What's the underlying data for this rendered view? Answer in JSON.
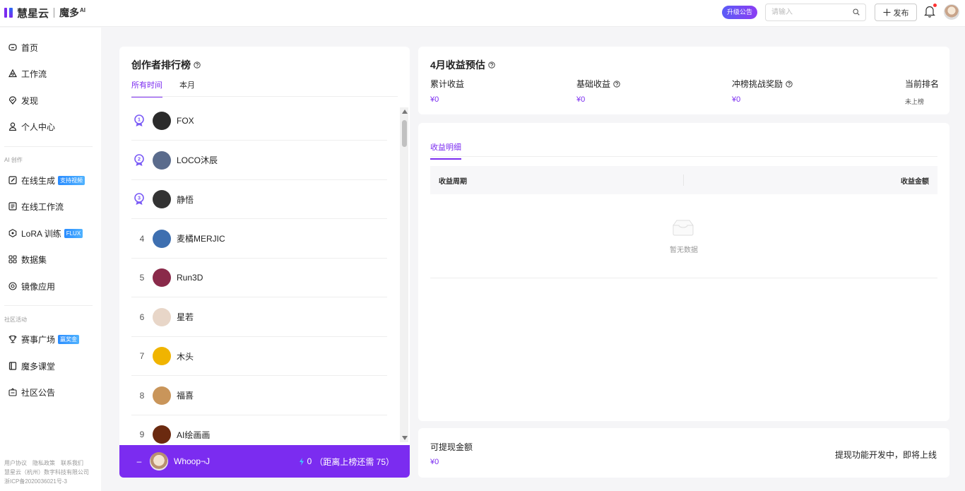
{
  "header": {
    "logo_text": "慧星云",
    "logo_sub": "魔多",
    "logo_sup": "AI",
    "announce_label": "升级公告",
    "search_placeholder": "请输入",
    "publish_label": "发布"
  },
  "sidebar": {
    "nav_main": [
      {
        "label": "首页",
        "icon": "home-icon"
      },
      {
        "label": "工作流",
        "icon": "workflow-icon"
      },
      {
        "label": "发现",
        "icon": "discover-icon"
      },
      {
        "label": "个人中心",
        "icon": "user-icon"
      }
    ],
    "section_ai": "AI 创作",
    "nav_ai": [
      {
        "label": "在线生成",
        "icon": "edit-icon",
        "badge": "支持视频"
      },
      {
        "label": "在线工作流",
        "icon": "doc-icon",
        "badge": ""
      },
      {
        "label": "LoRA 训练",
        "icon": "lora-icon",
        "badge": "FLUX"
      },
      {
        "label": "数据集",
        "icon": "dataset-icon",
        "badge": ""
      },
      {
        "label": "镜像应用",
        "icon": "mirror-icon",
        "badge": ""
      }
    ],
    "section_community": "社区活动",
    "nav_community": [
      {
        "label": "赛事广场",
        "icon": "trophy-icon",
        "badge": "赢奖金"
      },
      {
        "label": "魔多课堂",
        "icon": "book-icon",
        "badge": ""
      },
      {
        "label": "社区公告",
        "icon": "announcement-icon",
        "badge": ""
      }
    ],
    "footer": {
      "links": [
        "用户协议",
        "隐私政策",
        "联系我们"
      ],
      "company": "慧星云（杭州）数字科技有限公司",
      "icp": "浙ICP备2020036021号-3"
    }
  },
  "leaderboard": {
    "title": "创作者排行榜",
    "tabs": [
      "所有时间",
      "本月"
    ],
    "active_tab": 0,
    "rows": [
      {
        "rank": "1",
        "name": "FOX",
        "avatar_color": "#2b2b2b"
      },
      {
        "rank": "2",
        "name": "LOCO沐辰",
        "avatar_color": "#5a6b8c"
      },
      {
        "rank": "3",
        "name": "静悟",
        "avatar_color": "#333333"
      },
      {
        "rank": "4",
        "name": "麦橘MERJIC",
        "avatar_color": "#3e6fb0"
      },
      {
        "rank": "5",
        "name": "Run3D",
        "avatar_color": "#8a2a4a"
      },
      {
        "rank": "6",
        "name": "星若",
        "avatar_color": "#e8d6c8"
      },
      {
        "rank": "7",
        "name": "木头",
        "avatar_color": "#f0b400"
      },
      {
        "rank": "8",
        "name": "福喜",
        "avatar_color": "#c9955a"
      },
      {
        "rank": "9",
        "name": "AI绘画画",
        "avatar_color": "#6b2a10"
      }
    ],
    "me": {
      "rank": "–",
      "name": "Whoop¬J",
      "score": "0",
      "note": "（距离上榜还需 75）"
    }
  },
  "income": {
    "title": "4月收益预估",
    "stats": [
      {
        "label": "累计收益",
        "value": "¥0",
        "help": false
      },
      {
        "label": "基础收益",
        "value": "¥0",
        "help": true
      },
      {
        "label": "冲榜挑战奖励",
        "value": "¥0",
        "help": true
      },
      {
        "label": "当前排名",
        "value": "未上榜",
        "help": false
      }
    ]
  },
  "detail": {
    "tab": "收益明细",
    "col_period": "收益周期",
    "col_amount": "收益金额",
    "empty_text": "暂无数据"
  },
  "withdraw": {
    "label": "可提现金额",
    "value": "¥0",
    "note": "提现功能开发中，即将上线"
  },
  "colors": {
    "accent": "#7b2cf0",
    "background": "#f5f5f7"
  }
}
